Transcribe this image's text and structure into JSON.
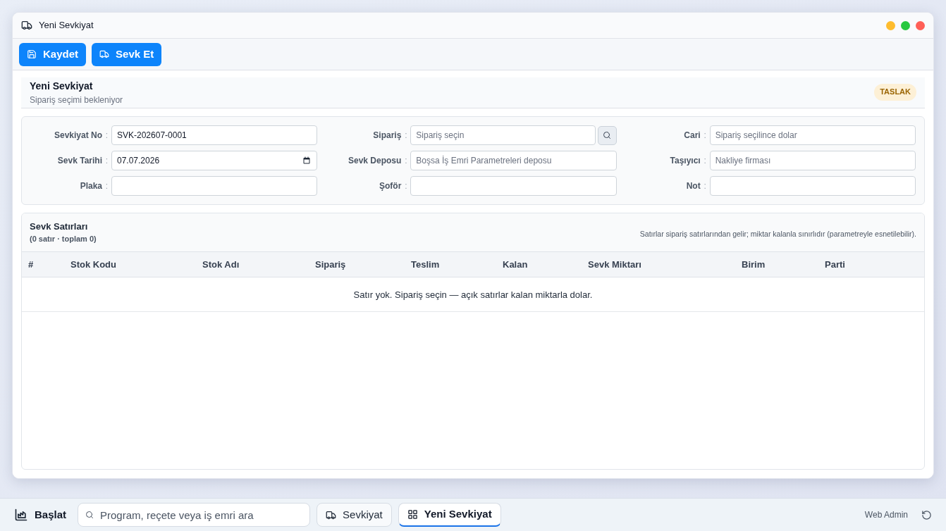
{
  "window": {
    "title": "Yeni Sevkiyat"
  },
  "toolbar": {
    "buttons": [
      {
        "label": "Kaydet",
        "kind": "save"
      },
      {
        "label": "Sevk Et",
        "kind": "ship"
      }
    ]
  },
  "document_header": {
    "title": "Yeni Sevkiyat",
    "subtitle": "Sipariş seçimi bekleniyor",
    "status_badge": "TASLAK"
  },
  "form": {
    "fields": [
      {
        "label": "Sevkiyat No",
        "colon": ":",
        "kind": "text",
        "value": "SVK-202607-0001"
      },
      {
        "label": "Sipariş",
        "colon": ":",
        "kind": "lookup",
        "placeholder": "Sipariş seçin"
      },
      {
        "label": "Cari",
        "colon": ":",
        "kind": "text",
        "placeholder": "Sipariş seçilince dolar"
      },
      {
        "label": "Sevk Tarihi",
        "colon": ":",
        "kind": "date",
        "value": "07.07.2026"
      },
      {
        "label": "Sevk Deposu",
        "colon": ":",
        "kind": "text",
        "placeholder": "Boşsa İş Emri Parametreleri deposu"
      },
      {
        "label": "Taşıyıcı",
        "colon": ":",
        "kind": "text",
        "placeholder": "Nakliye firması"
      },
      {
        "label": "Plaka",
        "colon": ":",
        "kind": "text"
      },
      {
        "label": "Şoför",
        "colon": ":",
        "kind": "text"
      },
      {
        "label": "Not",
        "colon": ":",
        "kind": "text"
      }
    ]
  },
  "lines": {
    "title": "Sevk Satırları",
    "summary": "(0 satır · toplam 0)",
    "note": "Satırlar sipariş satırlarından gelir; miktar kalanla sınırlıdır (parametreyle esnetilebilir).",
    "table": {
      "columns": [
        "#",
        "Stok Kodu",
        "Stok Adı",
        "Sipariş",
        "Teslim",
        "Kalan",
        "Sevk Miktarı",
        "Birim",
        "Parti"
      ],
      "empty_message": "Satır yok. Sipariş seçin — açık satırlar kalan miktarla dolar."
    }
  },
  "taskbar": {
    "start": "Başlat",
    "search": {
      "placeholder": "Program, reçete veya iş emri ara"
    },
    "tasks": [
      {
        "label": "Sevkiyat",
        "kind": "module",
        "selected": false
      },
      {
        "label": "Yeni Sevkiyat",
        "kind": "form",
        "selected": true
      }
    ],
    "user": "Web Admin"
  }
}
